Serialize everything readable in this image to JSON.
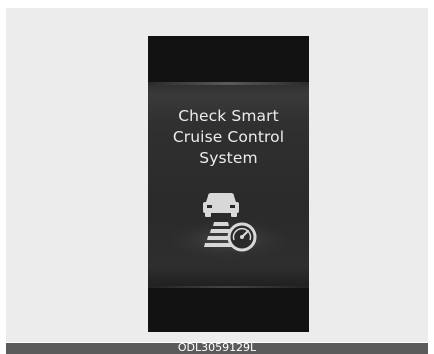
{
  "display": {
    "message": "Check Smart\nCruise Control\nSystem",
    "icon": "smart-cruise-control-warning-icon",
    "text_color": "#ececec",
    "background_color": "#121212"
  },
  "caption": {
    "code": "ODL3059129L"
  }
}
